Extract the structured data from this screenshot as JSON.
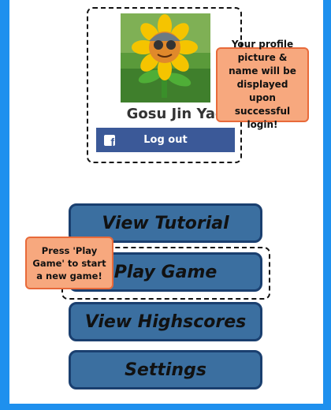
{
  "profile": {
    "name": "Gosu Jin Yao",
    "logout_label": "Log out",
    "avatar_alt": "sunflower-avatar"
  },
  "callouts": {
    "profile_hint": "Your profile picture & name will be displayed upon successful login!",
    "play_hint": "Press 'Play Game' to start a new game!"
  },
  "menu": {
    "view_tutorial": "View Tutorial",
    "play_game": "Play Game",
    "view_highscores": "View Highscores",
    "settings": "Settings"
  },
  "colors": {
    "background": "#1e90ee",
    "facebook": "#3b5998",
    "menu_button": "#3b6fa0",
    "callout": "#f7a87e"
  }
}
